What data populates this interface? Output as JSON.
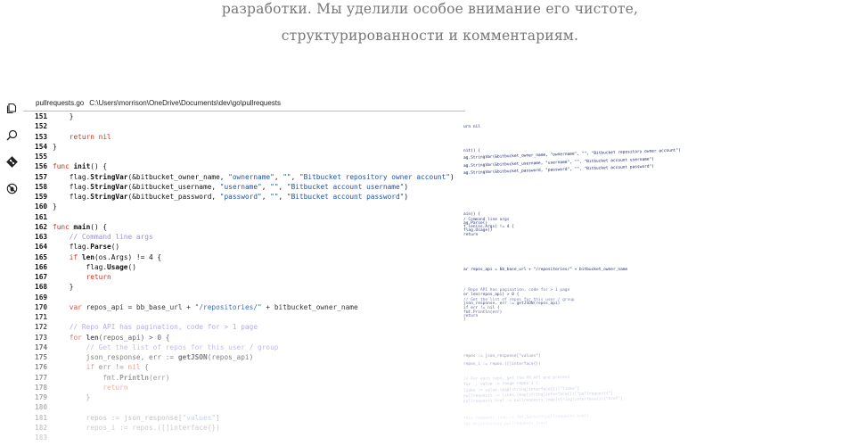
{
  "intro": {
    "line1": "разработки. Мы уделили особое внимание его чистоте,",
    "line2": "структурированности и комментариям."
  },
  "activity_bar": {
    "icons": [
      "files-icon",
      "search-icon",
      "source-control-icon",
      "debug-icon"
    ]
  },
  "editor": {
    "file_name": "pullrequests.go",
    "file_path": "C:\\Users\\morrison\\OneDrive\\Documents\\dev\\go\\pullrequests",
    "lines": [
      {
        "n": "151",
        "text": "    }"
      },
      {
        "n": "152",
        "text": ""
      },
      {
        "n": "153",
        "text": "    return nil"
      },
      {
        "n": "154",
        "text": "}"
      },
      {
        "n": "155",
        "text": ""
      },
      {
        "n": "156",
        "text": "func init() {"
      },
      {
        "n": "157",
        "text": "    flag.StringVar(&bitbucket_owner_name, \"ownername\", \"\", \"Bitbucket repository owner account\")"
      },
      {
        "n": "158",
        "text": "    flag.StringVar(&bitbucket_username, \"username\", \"\", \"Bitbucket account username\")"
      },
      {
        "n": "159",
        "text": "    flag.StringVar(&bitbucket_password, \"password\", \"\", \"Bitbucket account password\")"
      },
      {
        "n": "160",
        "text": "}"
      },
      {
        "n": "161",
        "text": ""
      },
      {
        "n": "162",
        "text": "func main() {"
      },
      {
        "n": "163",
        "text": "    // Command line args"
      },
      {
        "n": "164",
        "text": "    flag.Parse()"
      },
      {
        "n": "165",
        "text": "    if len(os.Args) != 4 {"
      },
      {
        "n": "166",
        "text": "        flag.Usage()"
      },
      {
        "n": "167",
        "text": "        return"
      },
      {
        "n": "168",
        "text": "    }"
      },
      {
        "n": "169",
        "text": ""
      },
      {
        "n": "170",
        "text": "    var repos_api = bb_base_url + \"/repositories/\" + bitbucket_owner_name"
      },
      {
        "n": "171",
        "text": ""
      },
      {
        "n": "172",
        "text": "    // Repo API has pagination, code for > 1 page"
      },
      {
        "n": "173",
        "text": "    for len(repos_api) > 0 {"
      },
      {
        "n": "174",
        "text": "        // Get the list of repos for this user / group"
      },
      {
        "n": "175",
        "text": "        json_response, err := getJSON(repos_api)"
      },
      {
        "n": "176",
        "text": "        if err != nil {"
      },
      {
        "n": "177",
        "text": "            fmt.Println(err)"
      },
      {
        "n": "178",
        "text": "            return"
      },
      {
        "n": "179",
        "text": "        }"
      },
      {
        "n": "180",
        "text": ""
      },
      {
        "n": "181",
        "text": "        repos := json_response[\"values\"]"
      },
      {
        "n": "182",
        "text": "        repos_i := repos.([]interface{})"
      },
      {
        "n": "183",
        "text": ""
      }
    ]
  },
  "minimap": {
    "lines": [
      "urn nil",
      "nit() {",
      "ag.StringVar(&bitbucket_owner_name, \"ownername\", \"\", \"Bitbucket repository owner account\")",
      "ag.StringVar(&bitbucket_username, \"username\", \"\", \"Bitbucket account username\")",
      "ag.StringVar(&bitbucket_password, \"password\", \"\", \"Bitbucket account password\")",
      "ain() {",
      "/ Command line args",
      "ag.Parse()",
      "f len(os.Args) != 4 {",
      "  flag.Usage()",
      "  return",
      "ar repos_api = bb_base_url + \"/repositories/\" + bitbucket_owner_name",
      "/ Repo API has pagination, code for > 1 page",
      "or len(repos_api) > 0 {",
      "  // Get the list of repos for this user / group",
      "  json_response, err := getJSON(repos_api)",
      "  if err != nil {",
      "      fmt.Println(err)",
      "      return",
      "  }",
      "  repos := json_response[\"values\"]",
      "  repos_i := repos.([]interface{})",
      "  // For each repo, get the PR API and process",
      "  for _, value := range repos_i {",
      "      links := value.(map[string]interface{})[\"links\"]",
      "      pullrequests := links.(map[string]interface{})[\"pullrequests\"]",
      "      pullrequests_href := pullrequests.(map[string]interface{})[\"href\"]",
      "      this_requests_json := fmt.Sprintf(pullrequests_href)",
      "      fmt.Println(this_pullrequests_json)"
    ]
  }
}
